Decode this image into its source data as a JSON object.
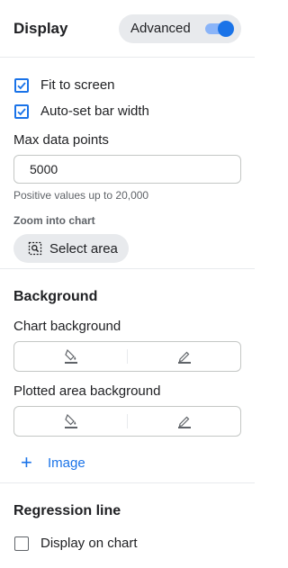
{
  "header": {
    "title": "Display",
    "advanced_label": "Advanced",
    "advanced_on": true
  },
  "display": {
    "fit_to_screen": {
      "label": "Fit to screen",
      "checked": true
    },
    "auto_bar_width": {
      "label": "Auto-set bar width",
      "checked": true
    },
    "max_points": {
      "label": "Max data points",
      "value": "5000",
      "hint": "Positive values up to 20,000"
    },
    "zoom": {
      "label": "Zoom into chart",
      "button": "Select area"
    }
  },
  "background": {
    "title": "Background",
    "chart_bg_label": "Chart background",
    "plotted_bg_label": "Plotted area background",
    "add_image_label": "Image"
  },
  "regression": {
    "title": "Regression line",
    "display_on_chart": {
      "label": "Display on chart",
      "checked": false
    }
  },
  "colors": {
    "accent": "#1a73e8",
    "toggle_track": "#8ab4f8",
    "pill_bg": "#e8eaed",
    "border": "#c4c7c5"
  }
}
